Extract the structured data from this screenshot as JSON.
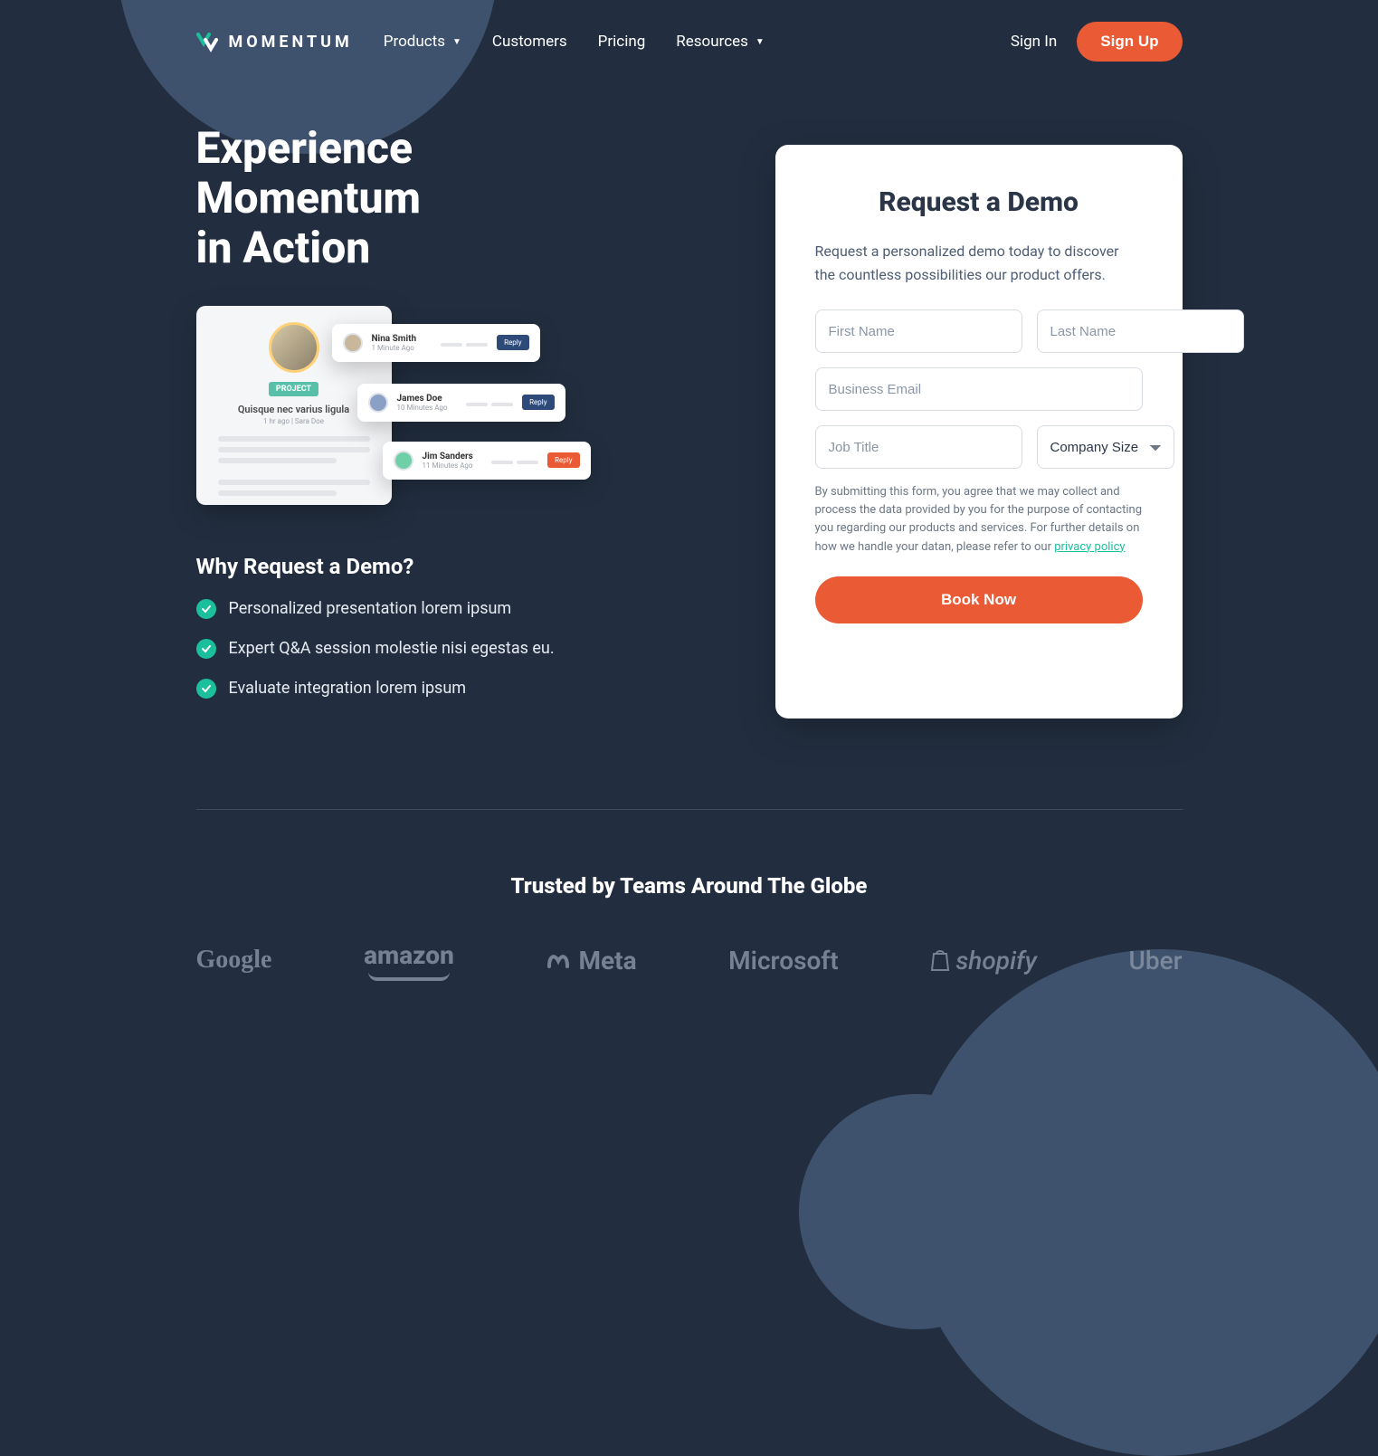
{
  "brand": "MOMENTUM",
  "nav": {
    "products": "Products",
    "customers": "Customers",
    "pricing": "Pricing",
    "resources": "Resources",
    "signin": "Sign In",
    "signup": "Sign Up"
  },
  "hero": {
    "title_l1": "Experience",
    "title_l2": "Momentum",
    "title_l3": "in Action",
    "why_title": "Why Request a Demo?",
    "bullets": [
      "Personalized presentation lorem ipsum",
      "Expert Q&A session molestie nisi egestas eu.",
      "Evaluate integration lorem ipsum"
    ]
  },
  "mock": {
    "chip": "PROJECT",
    "title": "Quisque nec varius ligula",
    "sub": "1 hr ago  |  Sara Doe",
    "c1_name": "Nina Smith",
    "c1_time": "1 Minute Ago",
    "c1_btn": "Reply",
    "c2_name": "James Doe",
    "c2_time": "10 Minutes Ago",
    "c2_btn": "Reply",
    "c3_name": "Jim Sanders",
    "c3_time": "11 Minutes Ago",
    "c3_btn": "Reply"
  },
  "form": {
    "title": "Request a Demo",
    "lead": "Request a personalized demo today to discover the countless possibilities our product offers.",
    "first_name_ph": "First Name",
    "last_name_ph": "Last Name",
    "email_ph": "Business Email",
    "job_ph": "Job Title",
    "company_size": "Company Size",
    "disclaimer_a": "By submitting this form, you agree that we may collect and process the data provided by you for the purpose of contacting you regarding our products and services. For further details on how we handle your datan, please refer to our ",
    "privacy": "privacy policy",
    "book": "Book Now"
  },
  "trusted": {
    "title": "Trusted by Teams Around The Globe",
    "logos": [
      "Google",
      "amazon",
      "Meta",
      "Microsoft",
      "shopify",
      "Uber"
    ]
  }
}
